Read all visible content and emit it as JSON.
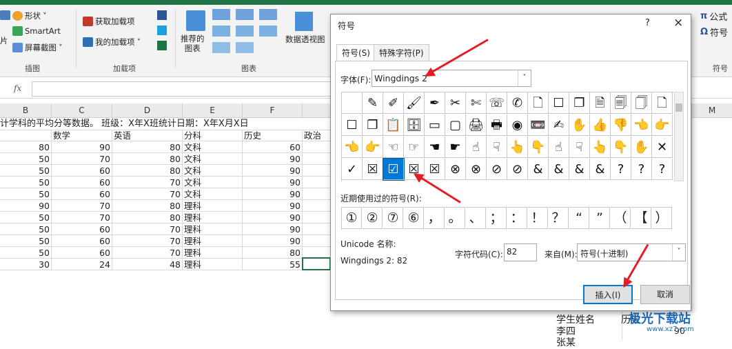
{
  "ribbon": {
    "shapes": "形状",
    "smartart": "SmartArt",
    "screenshot": "屏幕截图",
    "illus_group": "插图",
    "get_addins": "获取加载项",
    "my_addins": "我的加载项",
    "addins_group": "加载项",
    "recommended_charts": "推荐的\n图表",
    "charts_group": "图表",
    "pivot_chart": "数据透视图",
    "formula": "公式",
    "symbol": "符号",
    "symbols_group": "符号",
    "left_cut": "片"
  },
  "formula_bar": {
    "fx": "fx"
  },
  "columns": [
    "B",
    "C",
    "D",
    "E",
    "F",
    "M"
  ],
  "sheet": {
    "title_row": "计学科的平均分等数据。 班级：X年X班统计日期：X年X月X日",
    "headers": [
      "数学",
      "英语",
      "分科",
      "历史",
      "政治"
    ],
    "rows": [
      [
        "80",
        "90",
        "80",
        "文科",
        "60"
      ],
      [
        "50",
        "70",
        "80",
        "文科",
        "90"
      ],
      [
        "50",
        "60",
        "80",
        "文科",
        "90"
      ],
      [
        "50",
        "60",
        "70",
        "文科",
        "90"
      ],
      [
        "50",
        "60",
        "70",
        "文科",
        "90"
      ],
      [
        "90",
        "70",
        "80",
        "理科",
        "90"
      ],
      [
        "50",
        "70",
        "80",
        "理科",
        "90"
      ],
      [
        "50",
        "60",
        "70",
        "理科",
        "90"
      ],
      [
        "50",
        "60",
        "70",
        "理科",
        "90"
      ],
      [
        "50",
        "60",
        "70",
        "理科",
        "80"
      ],
      [
        "30",
        "24",
        "48",
        "理科",
        "55"
      ]
    ],
    "lower_right": {
      "name_header": "学生姓名",
      "history_header": "历史",
      "name1": "李四",
      "value1": "90",
      "name2": "张某"
    }
  },
  "dialog": {
    "title": "符号",
    "help": "?",
    "close": "×",
    "tabs": [
      "符号(S)",
      "特殊字符(P)"
    ],
    "font_label": "字体(F):",
    "font_value": "Wingdings 2",
    "symbols": [
      [
        "",
        "✎",
        "✐",
        "🖌",
        "✒",
        "✂",
        "✄",
        "☏",
        "✆",
        "🗋",
        "☐",
        "❐",
        "🗎",
        "🗐",
        "🗍",
        "🗋"
      ],
      [
        "☐",
        "❐",
        "📋",
        "🗄",
        "▭",
        "▢",
        "🖨",
        "🖶",
        "◉",
        "📼",
        "✍",
        "✋",
        "👍",
        "👎",
        "👈",
        "👉"
      ],
      [
        "👈",
        "👉",
        "☜",
        "☞",
        "☚",
        "☛",
        "☝",
        "☟",
        "👆",
        "👇",
        "☝",
        "☟",
        "👆",
        "👇",
        "✋",
        "✕"
      ],
      [
        "✓",
        "☒",
        "☑",
        "☒",
        "☒",
        "⊗",
        "⊗",
        "⊘",
        "⊘",
        "&",
        "&",
        "&",
        "&",
        "?",
        "?",
        "?"
      ]
    ],
    "selected": {
      "row": 3,
      "col": 2
    },
    "recent_label": "近期使用过的符号(R):",
    "recent": [
      "①",
      "②",
      "⑦",
      "⑥",
      "，",
      "。",
      "、",
      "；",
      "：",
      "！",
      "？",
      "“",
      "”",
      "（",
      "【",
      "）"
    ],
    "unicode_label": "Unicode 名称:",
    "unicode_value": "Wingdings 2: 82",
    "code_label": "字符代码(C):",
    "code_value": "82",
    "from_label": "来自(M):",
    "from_value": "符号(十进制)",
    "insert": "插入(I)",
    "cancel": "取消"
  },
  "watermark": {
    "text": "极光下载站",
    "url": "www.xz7.com"
  },
  "colors": {
    "excel_green": "#217346",
    "selection_blue": "#0078d7",
    "arrow_red": "#e51c23"
  }
}
